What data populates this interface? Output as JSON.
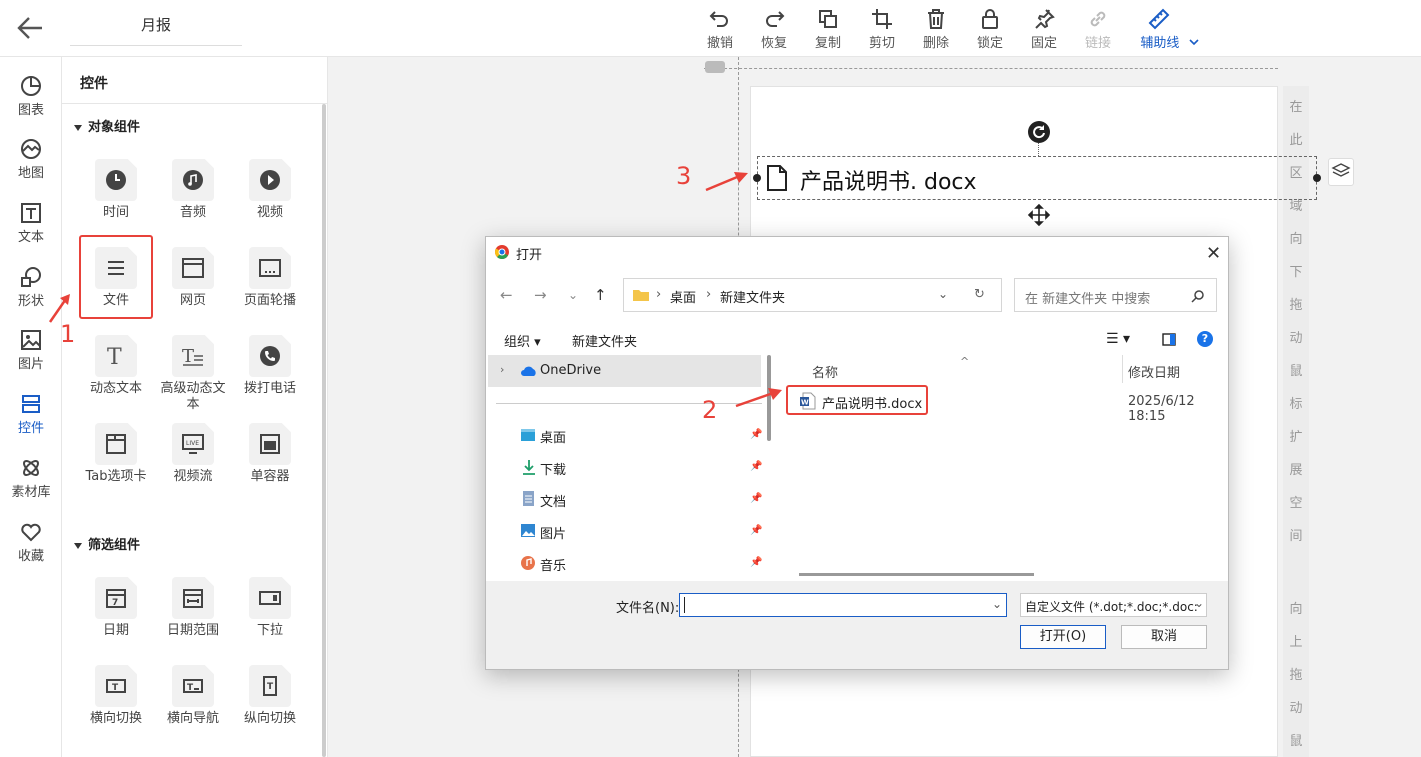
{
  "header": {
    "title": "月报"
  },
  "toolbar": {
    "undo": "撤销",
    "redo": "恢复",
    "copy": "复制",
    "cut": "剪切",
    "delete": "删除",
    "lock": "锁定",
    "pin": "固定",
    "link": "链接",
    "guides": "辅助线"
  },
  "rail": {
    "items": [
      {
        "label": "图表"
      },
      {
        "label": "地图"
      },
      {
        "label": "文本"
      },
      {
        "label": "形状"
      },
      {
        "label": "图片"
      },
      {
        "label": "控件"
      },
      {
        "label": "素材库"
      },
      {
        "label": "收藏"
      }
    ]
  },
  "panel": {
    "title": "控件",
    "section1": "对象组件",
    "section2": "筛选组件",
    "widgets1": [
      {
        "label": "时间"
      },
      {
        "label": "音频"
      },
      {
        "label": "视频"
      },
      {
        "label": "文件"
      },
      {
        "label": "网页"
      },
      {
        "label": "页面轮播"
      },
      {
        "label": "动态文本"
      },
      {
        "label": "高级动态文本"
      },
      {
        "label": "拨打电话"
      },
      {
        "label": "Tab选项卡"
      },
      {
        "label": "视频流"
      },
      {
        "label": "单容器"
      }
    ],
    "widgets2": [
      {
        "label": "日期"
      },
      {
        "label": "日期范围"
      },
      {
        "label": "下拉"
      },
      {
        "label": "横向切换"
      },
      {
        "label": "横向导航"
      },
      {
        "label": "纵向切换"
      }
    ]
  },
  "canvas": {
    "file_widget_name": "产品说明书. docx",
    "vertical_hint": [
      "在",
      "此",
      "区",
      "域",
      "向",
      "下",
      "拖",
      "动",
      "鼠",
      "标",
      "扩",
      "展",
      "空",
      "间",
      "向",
      "上",
      "拖",
      "动",
      "鼠"
    ]
  },
  "annotations": {
    "a1": "1",
    "a2": "2",
    "a3": "3"
  },
  "dialog": {
    "title": "打开",
    "path": [
      "桌面",
      "新建文件夹"
    ],
    "search_placeholder": "在 新建文件夹 中搜索",
    "organize": "组织",
    "new_folder": "新建文件夹",
    "tree": [
      "OneDrive",
      "桌面",
      "下载",
      "文档",
      "图片",
      "音乐"
    ],
    "col_name": "名称",
    "col_date": "修改日期",
    "file": {
      "name": "产品说明书.docx",
      "date": "2025/6/12 18:15"
    },
    "filename_label": "文件名(N):",
    "filename_value": "",
    "filetype": "自定义文件 (*.dot;*.doc;*.doc:",
    "open": "打开(O)",
    "cancel": "取消"
  },
  "colors": {
    "accent": "#1a5dc6",
    "annotation": "#e8423a"
  }
}
